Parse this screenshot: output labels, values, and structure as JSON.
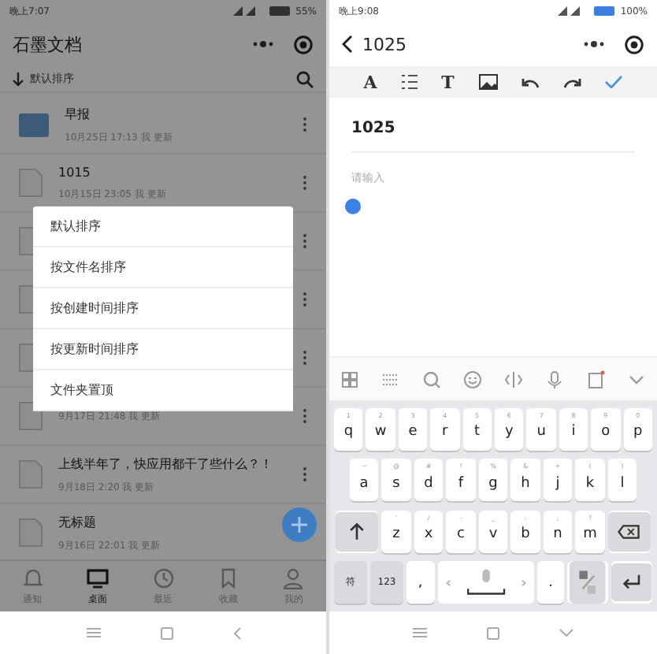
{
  "left_phone": {
    "status_time": "晚上7:07",
    "battery": "55%",
    "app_title": "石墨文档",
    "sort_label": "默认排序",
    "files": [
      {
        "kind": "folder",
        "title": "早报",
        "meta": "10月25日 17:13 我 更新"
      },
      {
        "kind": "document",
        "title": "1015",
        "meta": "10月15日 23:05 我 更新"
      },
      {
        "kind": "document"
      },
      {
        "kind": "document"
      },
      {
        "kind": "document"
      },
      {
        "kind": "document",
        "meta": "9月17日 21:48 我 更新"
      },
      {
        "kind": "document",
        "title": "上线半年了，快应用都干了些什么？！",
        "meta": "9月18日 2:20 我 更新"
      },
      {
        "kind": "document",
        "title": "无标题",
        "meta": "9月16日 22:01 我 更新"
      }
    ],
    "menu": [
      "默认排序",
      "按文件名排序",
      "按创建时间排序",
      "按更新时间排序",
      "文件夹置顶"
    ],
    "nav": [
      {
        "kind": "bell",
        "label": "通知",
        "selected": false
      },
      {
        "kind": "monitor",
        "label": "桌面",
        "selected": true
      },
      {
        "kind": "clock",
        "label": "最近",
        "selected": false
      },
      {
        "kind": "bookmark",
        "label": "收藏",
        "selected": false
      },
      {
        "kind": "person",
        "label": "我的",
        "selected": false
      }
    ]
  },
  "right_phone": {
    "status_time": "晚上9:08",
    "battery": "100%",
    "doc_title": "1025",
    "toolbar": [
      {
        "kind": "glyph",
        "label": "A"
      },
      {
        "kind": "list"
      },
      {
        "kind": "glyph",
        "label": "T"
      },
      {
        "kind": "image"
      },
      {
        "kind": "undo"
      },
      {
        "kind": "redo"
      },
      {
        "kind": "check"
      }
    ],
    "title_text": "1025",
    "placeholder": "请输入",
    "keyboard_tools": [
      {
        "kind": "grid"
      },
      {
        "kind": "keyboard"
      },
      {
        "kind": "search"
      },
      {
        "kind": "smiley"
      },
      {
        "kind": "cursor"
      },
      {
        "kind": "mic"
      },
      {
        "kind": "clipboard"
      },
      {
        "kind": "chevron"
      }
    ],
    "key_rows": [
      [
        {
          "key": "q",
          "hint": "1"
        },
        {
          "key": "w",
          "hint": "2"
        },
        {
          "key": "e",
          "hint": "3"
        },
        {
          "key": "r",
          "hint": "4"
        },
        {
          "key": "t",
          "hint": "5"
        },
        {
          "key": "y",
          "hint": "6"
        },
        {
          "key": "u",
          "hint": "7"
        },
        {
          "key": "i",
          "hint": "8"
        },
        {
          "key": "o",
          "hint": "9"
        },
        {
          "key": "p",
          "hint": "0"
        }
      ],
      [
        {
          "key": "a",
          "hint": "~"
        },
        {
          "key": "s",
          "hint": "@"
        },
        {
          "key": "d",
          "hint": "#"
        },
        {
          "key": "f",
          "hint": "!"
        },
        {
          "key": "g",
          "hint": "%"
        },
        {
          "key": "h",
          "hint": "&"
        },
        {
          "key": "j",
          "hint": "+"
        },
        {
          "key": "k",
          "hint": "("
        },
        {
          "key": "l",
          "hint": ")"
        }
      ],
      [
        {
          "key": "z",
          "hint": "'"
        },
        {
          "key": "x",
          "hint": "/"
        },
        {
          "key": "c",
          "hint": "-"
        },
        {
          "key": "v",
          "hint": "_"
        },
        {
          "key": "b",
          "hint": ":"
        },
        {
          "key": "n",
          "hint": ";"
        },
        {
          "key": "m",
          "hint": "?"
        }
      ]
    ],
    "bottom_keys": [
      {
        "kind": "text",
        "label": "符"
      },
      {
        "kind": "text",
        "label": "123"
      },
      {
        "kind": "char",
        "label": ","
      },
      {
        "kind": "space"
      },
      {
        "kind": "char",
        "label": "."
      },
      {
        "kind": "lang"
      },
      {
        "kind": "enter"
      }
    ]
  }
}
